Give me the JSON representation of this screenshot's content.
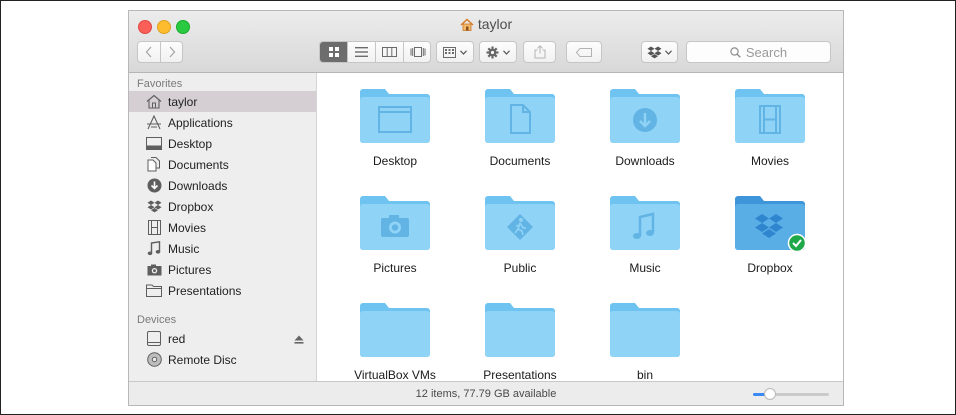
{
  "window": {
    "title": "taylor"
  },
  "toolbar": {
    "search_placeholder": "Search"
  },
  "sidebar": {
    "favorites_heading": "Favorites",
    "favorites": [
      {
        "label": "taylor",
        "icon": "home-icon",
        "selected": true
      },
      {
        "label": "Applications",
        "icon": "applications-icon"
      },
      {
        "label": "Desktop",
        "icon": "desktop-icon"
      },
      {
        "label": "Documents",
        "icon": "documents-icon"
      },
      {
        "label": "Downloads",
        "icon": "downloads-icon"
      },
      {
        "label": "Dropbox",
        "icon": "dropbox-icon"
      },
      {
        "label": "Movies",
        "icon": "movies-icon"
      },
      {
        "label": "Music",
        "icon": "music-icon"
      },
      {
        "label": "Pictures",
        "icon": "pictures-icon"
      },
      {
        "label": "Presentations",
        "icon": "folder-icon"
      }
    ],
    "devices_heading": "Devices",
    "devices": [
      {
        "label": "red",
        "icon": "drive-icon",
        "ejectable": true
      },
      {
        "label": "Remote Disc",
        "icon": "disc-icon"
      }
    ]
  },
  "items": [
    {
      "label": "Desktop",
      "icon": "desktop-folder-icon"
    },
    {
      "label": "Documents",
      "icon": "documents-folder-icon"
    },
    {
      "label": "Downloads",
      "icon": "downloads-folder-icon"
    },
    {
      "label": "Movies",
      "icon": "movies-folder-icon"
    },
    {
      "label": "Pictures",
      "icon": "pictures-folder-icon"
    },
    {
      "label": "Public",
      "icon": "public-folder-icon"
    },
    {
      "label": "Music",
      "icon": "music-folder-icon"
    },
    {
      "label": "Dropbox",
      "icon": "dropbox-folder-icon",
      "synced": true
    },
    {
      "label": "VirtualBox VMs",
      "icon": "folder-icon"
    },
    {
      "label": "Presentations",
      "icon": "folder-icon"
    },
    {
      "label": "bin",
      "icon": "folder-icon"
    }
  ],
  "status": {
    "text": "12 items, 77.79 GB available",
    "icon_size_level": 0.22
  },
  "colors": {
    "folder": "#7fcdf5",
    "selection": "#d5cfd4",
    "accent": "#3b89f5",
    "synced": "#1fa84a"
  }
}
